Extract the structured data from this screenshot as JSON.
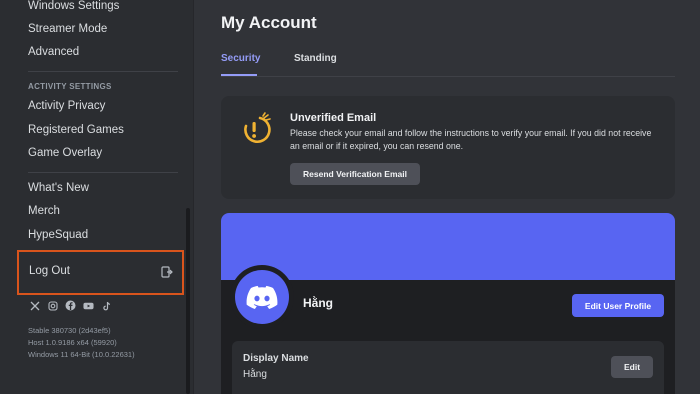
{
  "sidebar": {
    "items_top": [
      "Windows Settings",
      "Streamer Mode",
      "Advanced"
    ],
    "activity_header": "ACTIVITY SETTINGS",
    "activity_items": [
      "Activity Privacy",
      "Registered Games",
      "Game Overlay"
    ],
    "misc_items": [
      "What's New",
      "Merch",
      "HypeSquad"
    ],
    "logout_label": "Log Out",
    "social_icons": [
      "x-icon",
      "instagram-icon",
      "facebook-icon",
      "youtube-icon",
      "tiktok-icon"
    ],
    "build_info": [
      "Stable 380730 (2d43ef5)",
      "Host 1.0.9186 x64 (59920)",
      "Windows 11 64-Bit (10.0.22631)"
    ]
  },
  "main": {
    "title": "My Account",
    "tabs": [
      {
        "label": "Security",
        "active": true
      },
      {
        "label": "Standing",
        "active": false
      }
    ],
    "warning": {
      "title": "Unverified Email",
      "text": "Please check your email and follow the instructions to verify your email. If you did not receive an email or if it expired, you can resend one.",
      "button": "Resend Verification Email",
      "icon": "warning-icon",
      "accent": "#f0b232"
    },
    "profile": {
      "username": "Hằng",
      "edit_profile_button": "Edit User Profile",
      "banner_color": "#5865f2",
      "display_name_label": "Display Name",
      "display_name_value": "Hằng",
      "edit_button": "Edit"
    }
  },
  "colors": {
    "highlight_border": "#d9541c",
    "accent": "#5865f2",
    "tab_active": "#949cf7"
  }
}
